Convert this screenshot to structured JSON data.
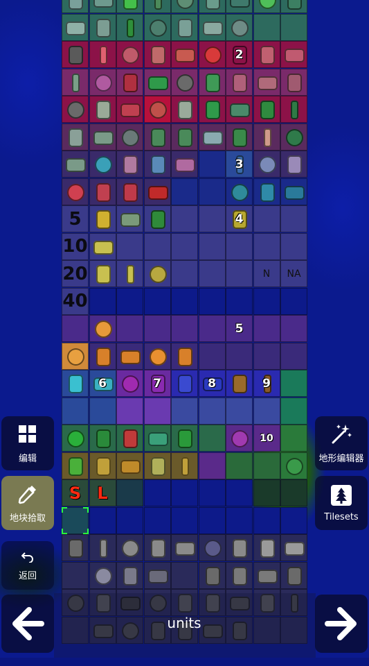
{
  "palette": {
    "rows": [
      {
        "cells": [
          "#2d6a5e",
          "#2d6a5e",
          "#2d6a5e",
          "#2d6a5e",
          "#2d6a5e",
          "#2d6a5e",
          "#2d6a5e",
          "#2d6a5e",
          "#2d6a5e"
        ],
        "sprites": [
          "#7aa09a",
          "#6e9a8e",
          "#44c04a",
          "#4c8a5a",
          "#5e8e74",
          "#6a9c8c",
          "#3f7a6c",
          "#4fbf59",
          "#3c7f62"
        ]
      },
      {
        "cells": [
          "#2d6a5e",
          "#2d6a5e",
          "#2d6a5e",
          "#2d6a5e",
          "#2d6a5e",
          "#2d6a5e",
          "#2d6a5e",
          "#2d6a5e",
          "#2d6a5e"
        ],
        "sprites": [
          "#8fb1a7",
          "#7c9d93",
          "#2f8f3a",
          "#4d7f6e",
          "#7aa097",
          "#8aa9a0",
          "#6f8c86",
          "",
          ""
        ]
      },
      {
        "cells": [
          "#8c1248",
          "#8c1248",
          "#8c1248",
          "#8c1248",
          "#8c1248",
          "#8c1248",
          "#8c1248",
          "#8c1248",
          "#8c1248"
        ],
        "sprites": [
          "#5a5a5a",
          "#e06070",
          "#c05a6a",
          "#c06a6a",
          "#c85a50",
          "#d83a3a",
          "#8c1248",
          "#c06070",
          "#c05a70"
        ]
      },
      {
        "cells": [
          "#7a2a6a",
          "#7a2a6a",
          "#7a2a6a",
          "#7a2a6a",
          "#7a2a6a",
          "#7a2a6a",
          "#7a2a6a",
          "#7a2a6a",
          "#7a2a6a"
        ],
        "sprites": [
          "#7aa088",
          "#b05aa0",
          "#b03040",
          "#2f9a4a",
          "#6a6a6a",
          "#3f9a56",
          "#b0607a",
          "#b06a7a",
          "#a05a70"
        ]
      },
      {
        "cells": [
          "#8c1248",
          "#8c1248",
          "#8c1248",
          "#b8103c",
          "#8c1248",
          "#8c1248",
          "#8c1248",
          "#8c1248",
          "#8c1248"
        ],
        "sprites": [
          "#6a6a6a",
          "#9aaa98",
          "#c04050",
          "#c0504a",
          "#9aaa9a",
          "#2f9a4a",
          "#4a8a6a",
          "#2f8a3f",
          "#2f7a46"
        ]
      },
      {
        "cells": [
          "#5a2a5e",
          "#5a2a5e",
          "#5a2a5e",
          "#5a2a5e",
          "#5a2a5e",
          "#5a2a5e",
          "#5a2a5e",
          "#5a2a5e",
          "#5a2a5e"
        ],
        "sprites": [
          "#8aa098",
          "#7a9a88",
          "#6a7a78",
          "#4a8a5a",
          "#4a8a5a",
          "#8aaab0",
          "#3a8a4a",
          "#d09a8a",
          "#2f7a4a"
        ]
      },
      {
        "cells": [
          "#3a2a6a",
          "#3a2a6a",
          "#3a2a6a",
          "#3a2a6a",
          "#3a2a6a",
          "#1a2a8a",
          "#2a4a9a",
          "#3a2a6a",
          "#3a2a6a"
        ],
        "sprites": [
          "#7a9a88",
          "#3aa0b8",
          "#b07aa0",
          "#5a8ab8",
          "#b06aa0",
          "",
          "#3a6aa8",
          "#7a8ab8",
          "#9a8ab8"
        ]
      },
      {
        "cells": [
          "#3a2a6a",
          "#3a2a6a",
          "#3a2a6a",
          "#3a2a6a",
          "#1a2a8a",
          "#1a2a8a",
          "#1a2a8a",
          "#1a2a8a",
          "#1a2a8a"
        ],
        "sprites": [
          "#d04050",
          "#c04050",
          "#c03a4a",
          "#c02a2a",
          "",
          "",
          "#2f8a9a",
          "#2f8aa8",
          "#2a7a9a"
        ]
      },
      {
        "cells": [
          "#3a3a8a",
          "#3a3a8a",
          "#3a3a8a",
          "#3a3a8a",
          "#3a3a8a",
          "#3a3a8a",
          "#3a3a8a",
          "#3a3a8a",
          "#3a3a8a"
        ],
        "sprites": [
          "",
          "#d0b030",
          "#7a9a7a",
          "#2f8a3a",
          "",
          "",
          "#b8a830",
          "",
          ""
        ]
      },
      {
        "cells": [
          "#3a3a8a",
          "#3a3a8a",
          "#3a3a8a",
          "#3a3a8a",
          "#3a3a8a",
          "#3a3a8a",
          "#3a3a8a",
          "#3a3a8a",
          "#3a3a8a"
        ],
        "sprites": [
          "",
          "#c8c050",
          "",
          "",
          "",
          "",
          "",
          "",
          ""
        ]
      },
      {
        "cells": [
          "#3a3a8a",
          "#3a3a8a",
          "#3a3a8a",
          "#3a3a8a",
          "#3a3a8a",
          "#3a3a8a",
          "#3a3a8a",
          "#3a3a8a",
          "#3a3a8a"
        ],
        "sprites": [
          "",
          "#c8c050",
          "#c8c050",
          "#b8a840",
          "",
          "",
          "",
          "",
          ""
        ]
      },
      {
        "cells": [
          "#3a3a8a",
          "#0d1a8a",
          "#0d1a8a",
          "#0d1a8a",
          "#0d1a8a",
          "#0d1a8a",
          "#0d1a8a",
          "#0d1a8a",
          "#0d1a8a"
        ],
        "sprites": [
          "",
          "",
          "",
          "",
          "",
          "",
          "",
          "",
          ""
        ]
      },
      {
        "cells": [
          "#4a2a8a",
          "#4a2a8a",
          "#4a2a8a",
          "#4a2a8a",
          "#4a2a8a",
          "#4a2a8a",
          "#4a2a8a",
          "#4a2a8a",
          "#4a2a8a"
        ],
        "sprites": [
          "",
          "#e89a3a",
          "",
          "",
          "",
          "",
          "",
          "",
          ""
        ]
      },
      {
        "cells": [
          "#d08a3a",
          "#3a2a7a",
          "#3a2a7a",
          "#3a2a7a",
          "#3a2a7a",
          "#3a2a7a",
          "#3a2a7a",
          "#3a2a7a",
          "#3a2a7a"
        ],
        "sprites": [
          "#e8a040",
          "#d8802a",
          "#d8802a",
          "#e89030",
          "#d8802a",
          "",
          "",
          "",
          ""
        ]
      },
      {
        "cells": [
          "#2a4a9a",
          "#2a4a9a",
          "#6a2aa0",
          "#6a2aa0",
          "#2a2ab0",
          "#2a2ab0",
          "#2a2ab0",
          "#2a2ab0",
          "#1a7a5a"
        ],
        "sprites": [
          "#3ac0d0",
          "#3ab0c0",
          "#a02ab0",
          "#8a2ab0",
          "#3a4ad0",
          "#2a3ac0",
          "#9a6a2a",
          "#8a5a2a",
          ""
        ]
      },
      {
        "cells": [
          "#2a4a9a",
          "#2a4a9a",
          "#6a3ab0",
          "#6a3ab0",
          "#3a4aa0",
          "#3a4aa0",
          "#3a4aa0",
          "#3a4aa0",
          "#1a7a5a"
        ],
        "sprites": [
          "",
          "",
          "",
          "",
          "",
          "",
          "",
          "",
          ""
        ]
      },
      {
        "cells": [
          "#2a6a4a",
          "#2a6a4a",
          "#2a6a4a",
          "#2a6a4a",
          "#2a6a4a",
          "#2a6a4a",
          "#5a2a8a",
          "#5a2a8a",
          "#2a7a3a"
        ],
        "sprites": [
          "#2ab03a",
          "#2a8a3a",
          "#c03a3a",
          "#3aa07a",
          "#2a9a3a",
          "",
          "#a03ab0",
          "",
          ""
        ]
      },
      {
        "cells": [
          "#6a5a2a",
          "#6a5a2a",
          "#6a5a2a",
          "#6a5a2a",
          "#6a5a2a",
          "#5a2a8a",
          "#2a6a3a",
          "#2a6a3a",
          "#2a7a3a"
        ],
        "sprites": [
          "#4ab03a",
          "#c0a03a",
          "#c08a2a",
          "#b0b05a",
          "#c0a03a",
          "",
          "",
          "",
          "#3a9a4a"
        ]
      },
      {
        "cells": [
          "#2a4a3a",
          "#2a4a3a",
          "#1a3a4a",
          "#0d1a8a",
          "#0d1a8a",
          "#0d1a8a",
          "#0d1a8a",
          "#1a3a2a",
          "#1a3a2a"
        ],
        "sprites": [
          "",
          "",
          "",
          "",
          "",
          "",
          "",
          "",
          ""
        ]
      },
      {
        "cells": [
          "#1a4a5a",
          "#0d1a8a",
          "#0d1a8a",
          "#0d1a8a",
          "#0d1a8a",
          "#0d1a8a",
          "#0d1a8a",
          "#0d1a8a",
          "#0d1a8a"
        ],
        "sprites": [
          "",
          "",
          "",
          "",
          "",
          "",
          "",
          "",
          ""
        ]
      },
      {
        "cells": [
          "#2a2a5a",
          "#2a2a5a",
          "#2a2a5a",
          "#2a2a5a",
          "#2a2a5a",
          "#2a2a5a",
          "#2a2a5a",
          "#2a2a5a",
          "#2a2a5a"
        ],
        "sprites": [
          "#6a6a6a",
          "#8a8a8a",
          "#8a8a8a",
          "#8a8a8a",
          "#8a8a8a",
          "#5a5a8a",
          "#8a8a8a",
          "#9a9a9a",
          "#9a9a9a"
        ]
      },
      {
        "cells": [
          "#2a2a5a",
          "#2a2a5a",
          "#2a2a5a",
          "#2a2a5a",
          "#2a2a5a",
          "#2a2a5a",
          "#2a2a5a",
          "#2a2a5a",
          "#2a2a5a"
        ],
        "sprites": [
          "",
          "#8a8aa0",
          "#7a7a8a",
          "#6a6a7a",
          "",
          "#6a6a6a",
          "#7a7a7a",
          "#7a7a7a",
          "#6a6a6a"
        ]
      },
      {
        "cells": [
          "#2a2a5a",
          "#2a2a5a",
          "#2a2a5a",
          "#2a2a5a",
          "#2a2a5a",
          "#2a2a5a",
          "#2a2a5a",
          "#2a2a5a",
          "#2a2a5a"
        ],
        "sprites": [
          "#4a4a4a",
          "#5a5a5a",
          "#3a3a3a",
          "#4a4a4a",
          "#5a5a5a",
          "#5a5a5a",
          "#4a4a4a",
          "#5a5a5a",
          "#4a4a4a"
        ]
      },
      {
        "cells": [
          "#2a2a5a",
          "#2a2a5a",
          "#2a2a5a",
          "#2a2a5a",
          "#2a2a5a",
          "#2a2a5a",
          "#2a2a5a",
          "#2a2a5a",
          "#2a2a5a"
        ],
        "sprites": [
          "",
          "#4a4a4a",
          "#4a4a4a",
          "#4a4a4a",
          "#4a4a4a",
          "#4a4a4a",
          "#4a4a4a",
          "",
          ""
        ]
      }
    ],
    "labels": [
      {
        "row": 2,
        "col": 6,
        "text": "2"
      },
      {
        "row": 6,
        "col": 6,
        "text": "3"
      },
      {
        "row": 8,
        "col": 0,
        "text": "5",
        "style": "big"
      },
      {
        "row": 8,
        "col": 6,
        "text": "4"
      },
      {
        "row": 9,
        "col": 0,
        "text": "10",
        "style": "big"
      },
      {
        "row": 10,
        "col": 0,
        "text": "20",
        "style": "big"
      },
      {
        "row": 10,
        "col": 7,
        "text": "N",
        "style": "dark"
      },
      {
        "row": 10,
        "col": 8,
        "text": "NA",
        "style": "dark"
      },
      {
        "row": 11,
        "col": 0,
        "text": "40",
        "style": "big"
      },
      {
        "row": 12,
        "col": 6,
        "text": "5"
      },
      {
        "row": 14,
        "col": 1,
        "text": "6"
      },
      {
        "row": 14,
        "col": 3,
        "text": "7"
      },
      {
        "row": 14,
        "col": 5,
        "text": "8"
      },
      {
        "row": 14,
        "col": 7,
        "text": "9"
      },
      {
        "row": 16,
        "col": 7,
        "text": "10",
        "style": "small"
      },
      {
        "row": 18,
        "col": 0,
        "text": "S",
        "style": "red"
      },
      {
        "row": 18,
        "col": 1,
        "text": "L",
        "style": "red"
      }
    ]
  },
  "sidebar_left": {
    "edit_label": "编辑",
    "tile_picker_label": "地块拾取",
    "back_label": "返回"
  },
  "sidebar_right": {
    "terrain_editor_label": "地形编辑器",
    "tilesets_label": "Tilesets"
  },
  "bottom": {
    "category_label": "units"
  },
  "colors": {
    "active_button": "#7a7a52",
    "water": "#0b1a8e"
  }
}
